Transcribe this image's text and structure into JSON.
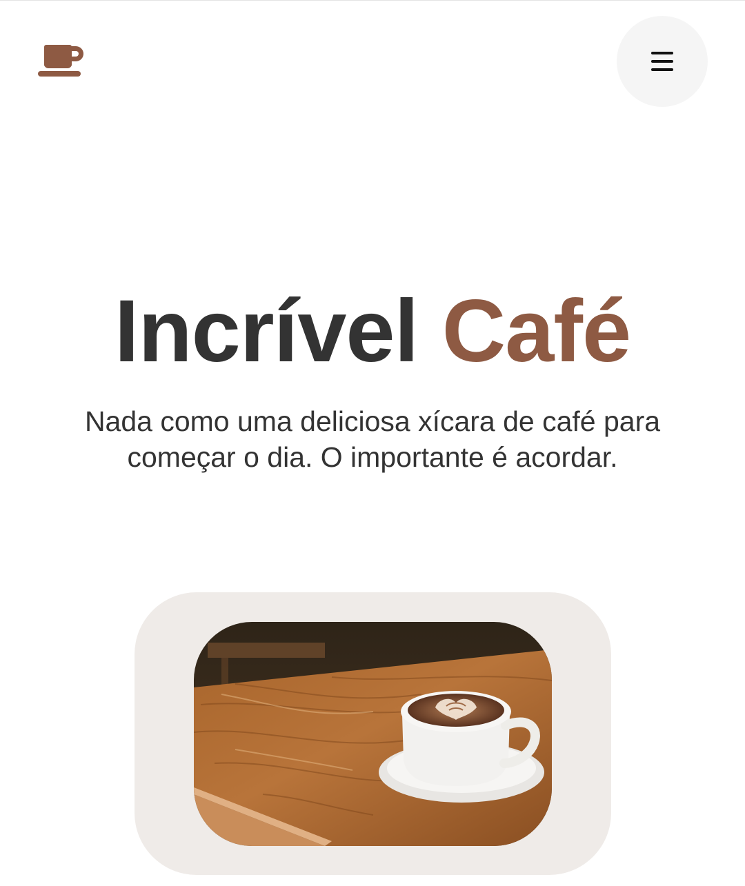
{
  "header": {
    "logo_icon": "coffee-cup-icon",
    "menu_icon": "hamburger-menu-icon"
  },
  "hero": {
    "title_main": "Incrível",
    "title_accent": "Café",
    "subtitle": "Nada como uma deliciosa xícara de café para começar o dia. O importante é acordar."
  },
  "colors": {
    "accent": "#8e5a43",
    "text": "#333333",
    "card_bg": "#efebe8",
    "menu_bg": "#f5f5f5"
  },
  "image": {
    "subject": "coffee-cup-on-wooden-table"
  }
}
